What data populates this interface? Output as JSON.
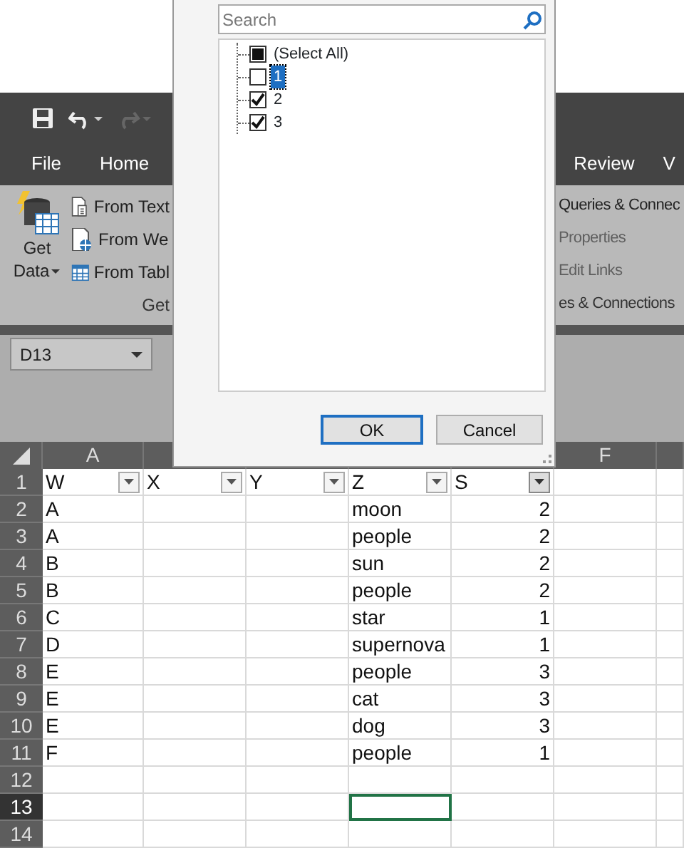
{
  "quick_access": {
    "redo_disabled": true
  },
  "tabs": [
    {
      "label": "File",
      "selected": false
    },
    {
      "label": "Home",
      "selected": false
    },
    {
      "label": "Review",
      "selected": false
    },
    {
      "label": "V",
      "selected": false
    }
  ],
  "ribbon": {
    "get_data": {
      "line1": "Get",
      "line2": "Data"
    },
    "left_items": [
      {
        "label": "From Text",
        "kind": "text"
      },
      {
        "label": "From We",
        "kind": "web"
      },
      {
        "label": "From Tabl",
        "kind": "table"
      }
    ],
    "left_group": "Get",
    "right_items": [
      {
        "label": "Queries & Connec",
        "disabled": false
      },
      {
        "label": "Properties",
        "disabled": true
      },
      {
        "label": "Edit Links",
        "disabled": true
      }
    ],
    "right_group": "es & Connections"
  },
  "name_box": "D13",
  "column_headers": [
    {
      "label": "A"
    },
    {
      "label": "F"
    }
  ],
  "table": {
    "columns": [
      {
        "label": "W",
        "filtered": false
      },
      {
        "label": "X",
        "filtered": false
      },
      {
        "label": "Y",
        "filtered": false
      },
      {
        "label": "Z",
        "filtered": false
      },
      {
        "label": "S",
        "filtered": true
      }
    ],
    "rows": [
      {
        "number": "1",
        "selected": false,
        "cells": []
      },
      {
        "number": "2",
        "selected": false,
        "cells": [
          "A",
          "",
          "",
          "moon",
          "2"
        ]
      },
      {
        "number": "3",
        "selected": false,
        "cells": [
          "A",
          "",
          "",
          "people",
          "2"
        ]
      },
      {
        "number": "4",
        "selected": false,
        "cells": [
          "B",
          "",
          "",
          "sun",
          "2"
        ]
      },
      {
        "number": "5",
        "selected": false,
        "cells": [
          "B",
          "",
          "",
          "people",
          "2"
        ]
      },
      {
        "number": "6",
        "selected": false,
        "cells": [
          "C",
          "",
          "",
          "star",
          "1"
        ]
      },
      {
        "number": "7",
        "selected": false,
        "cells": [
          "D",
          "",
          "",
          "supernova",
          "1"
        ]
      },
      {
        "number": "8",
        "selected": false,
        "cells": [
          "E",
          "",
          "",
          "people",
          "3"
        ]
      },
      {
        "number": "9",
        "selected": false,
        "cells": [
          "E",
          "",
          "",
          "cat",
          "3"
        ]
      },
      {
        "number": "10",
        "selected": false,
        "cells": [
          "E",
          "",
          "",
          "dog",
          "3"
        ]
      },
      {
        "number": "11",
        "selected": false,
        "cells": [
          "F",
          "",
          "",
          "people",
          "1"
        ]
      },
      {
        "number": "12",
        "selected": false,
        "cells": [
          "",
          "",
          "",
          "",
          ""
        ]
      },
      {
        "number": "13",
        "selected": true,
        "cells": [
          "",
          "",
          "",
          "",
          ""
        ]
      },
      {
        "number": "14",
        "selected": false,
        "cells": [
          "",
          "",
          "",
          "",
          ""
        ]
      }
    ]
  },
  "filter_popup": {
    "search": {
      "placeholder": "Search"
    },
    "items": [
      {
        "label": "(Select All)",
        "checked": false,
        "indeterminate": true,
        "selected": false
      },
      {
        "label": "1",
        "checked": false,
        "indeterminate": false,
        "selected": true
      },
      {
        "label": "2",
        "checked": true,
        "indeterminate": false,
        "selected": false
      },
      {
        "label": "3",
        "checked": true,
        "indeterminate": false,
        "selected": false
      }
    ],
    "buttons": [
      {
        "label": "OK",
        "default": true
      },
      {
        "label": "Cancel",
        "default": false
      }
    ]
  }
}
